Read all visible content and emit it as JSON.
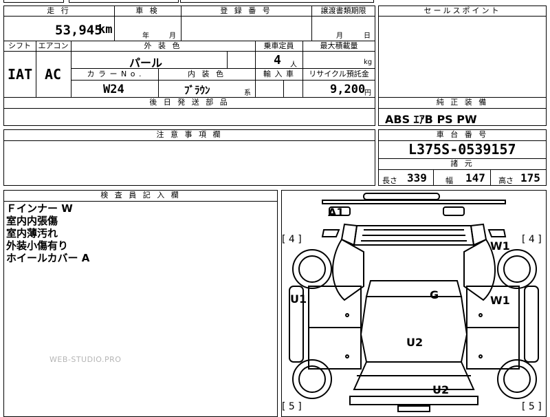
{
  "header": {
    "mileage_label": "走 行",
    "shaken_label": "車 検",
    "reg_label": "登 録 番 号",
    "transfer_label": "譲渡書類期限"
  },
  "mileage": {
    "value": "53,945",
    "unit": "km"
  },
  "shaken": {
    "year_unit": "年",
    "month_unit": "月"
  },
  "transfer": {
    "month_unit": "月",
    "day_unit": "日"
  },
  "row2_labels": {
    "shift": "シフト",
    "ac": "エアコン",
    "exterior_color": "外 装 色",
    "capacity": "乗車定員",
    "max_load": "最大積載量"
  },
  "shift": "IAT",
  "ac": "AC",
  "exterior_color": "パール",
  "capacity": {
    "value": "4",
    "unit": "人"
  },
  "max_load": {
    "unit": "kg"
  },
  "row3_labels": {
    "color_no": "カ ラ ー N o .",
    "interior_color": "内 装 色",
    "import": "輸 入 車",
    "recycle": "リサイクル預託金"
  },
  "color_no": "W24",
  "interior_color": {
    "value": "ﾌﾞﾗｳﾝ",
    "suffix": "系"
  },
  "recycle": {
    "value": "9,200",
    "unit": "円"
  },
  "later_parts_label": "後 日 発 送 部 品",
  "sales_point_label": "セールスポイント",
  "equipment": {
    "label": "純 正 装 備",
    "value": "ABS ｴｱB PS PW"
  },
  "caution_label": "注 意 事 項 欄",
  "chassis": {
    "label": "車 台 番 号",
    "value": "L375S-0539157"
  },
  "dimensions": {
    "label": "諸 元",
    "length_label": "長さ",
    "length": "339",
    "width_label": "幅",
    "width": "147",
    "height_label": "高さ",
    "height": "175"
  },
  "inspector": {
    "label": "検 査 員 記 入 欄",
    "notes": [
      "Ｆインナー W",
      "室内内張傷",
      "室内薄汚れ",
      "外装小傷有り",
      "ホイールカバー A"
    ]
  },
  "diagram": {
    "marks": [
      "A1",
      "W1",
      "W1",
      "U1",
      "G",
      "U2",
      "U2"
    ],
    "tire_labels": [
      "[ 4 ]",
      "[ 4 ]",
      "[ 5 ]",
      "[ 5 ]"
    ]
  },
  "watermark": "WEB-STUDIO.PRO"
}
